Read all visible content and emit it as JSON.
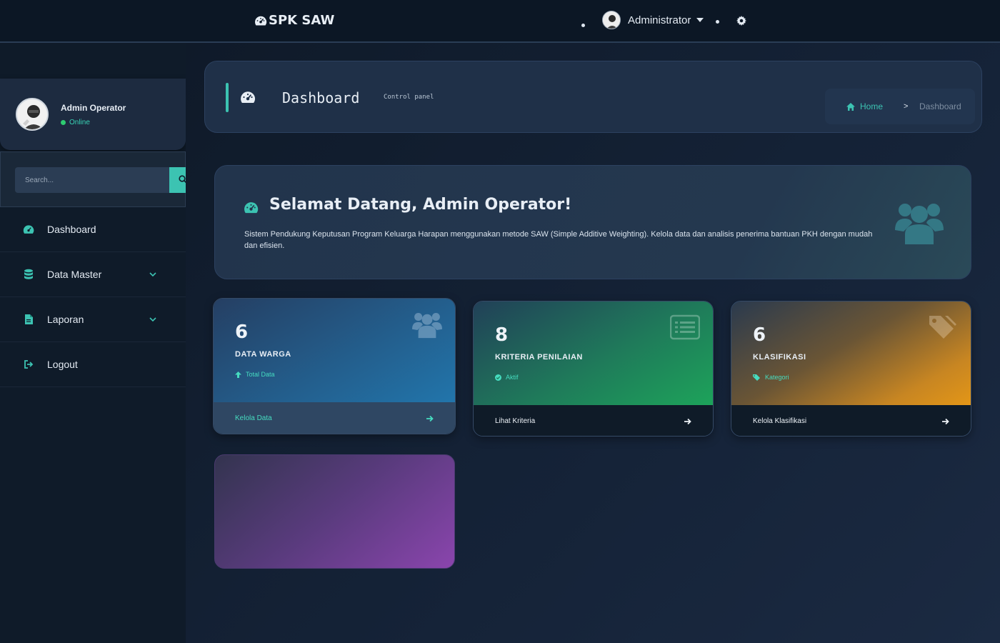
{
  "navbar": {
    "brand": "SPK SAW",
    "username": "Administrator"
  },
  "sidebar": {
    "user_name": "Admin Operator",
    "user_status": "Online",
    "search_placeholder": "Search...",
    "items": [
      {
        "label": "Dashboard",
        "icon": "dashboard-icon"
      },
      {
        "label": "Data Master",
        "icon": "database-icon"
      },
      {
        "label": "Laporan",
        "icon": "file-icon"
      },
      {
        "label": "Logout",
        "icon": "logout-icon"
      }
    ]
  },
  "header": {
    "title": "Dashboard",
    "subtitle": "Control panel",
    "breadcrumb_home": "Home",
    "breadcrumb_sep": ">",
    "breadcrumb_current": "Dashboard"
  },
  "welcome": {
    "title": "Selamat Datang, Admin Operator!",
    "text": "Sistem Pendukung Keputusan Program Keluarga Harapan menggunakan metode SAW (Simple Additive Weighting). Kelola data dan analisis penerima bantuan PKH dengan mudah dan efisien."
  },
  "stats": [
    {
      "value": "6",
      "label": "DATA WARGA",
      "meta": "Total Data",
      "footer": "Kelola Data",
      "icon": "users-icon"
    },
    {
      "value": "8",
      "label": "KRITERIA PENILAIAN",
      "meta": "Aktif",
      "footer": "Lihat Kriteria",
      "icon": "list-icon"
    },
    {
      "value": "6",
      "label": "KLASIFIKASI",
      "meta": "Kategori",
      "footer": "Kelola Klasifikasi",
      "icon": "tags-icon"
    }
  ],
  "colors": {
    "accent": "#3cc3b2",
    "online": "#2ecc71",
    "card_blue": "#2275ab",
    "card_green": "#1da35a",
    "card_orange": "#e39617",
    "card_purple": "#8a45ad"
  }
}
